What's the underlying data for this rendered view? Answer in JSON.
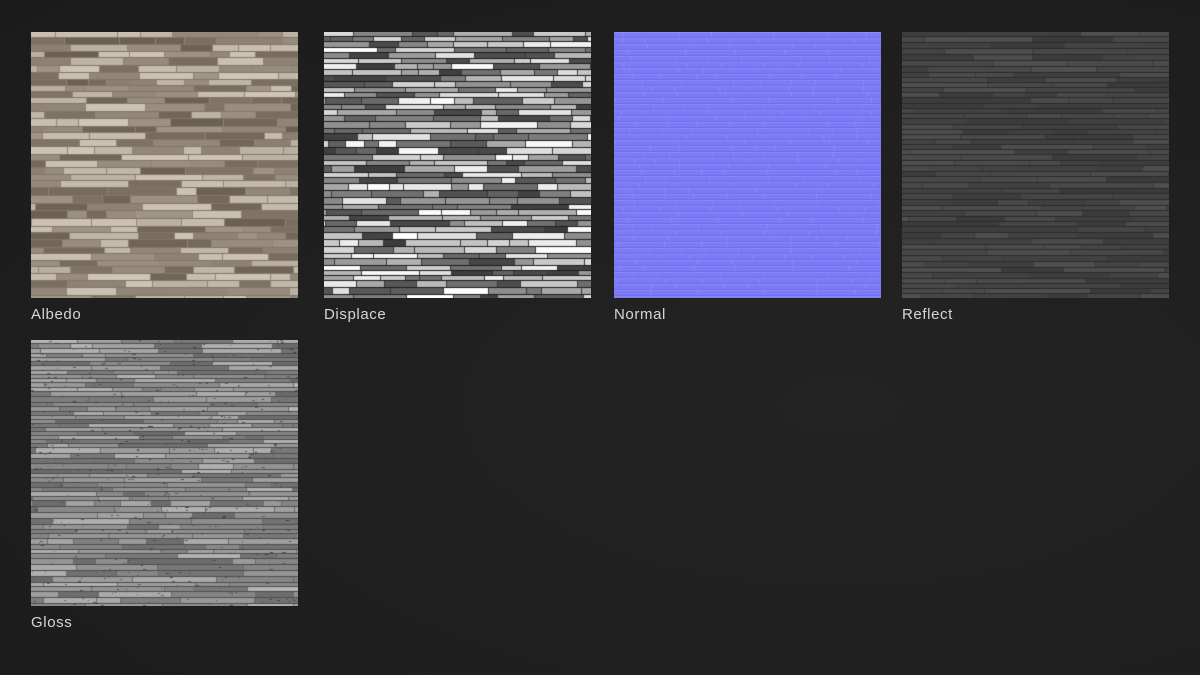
{
  "maps": [
    {
      "label": "Albedo",
      "kind": "albedo"
    },
    {
      "label": "Displace",
      "kind": "displace"
    },
    {
      "label": "Normal",
      "kind": "normal"
    },
    {
      "label": "Reflect",
      "kind": "reflect"
    },
    {
      "label": "Gloss",
      "kind": "gloss"
    }
  ],
  "colors": {
    "background": "#1f1f1f",
    "label_text": "#d6d6d6",
    "normal_base": "#7a7bf6"
  }
}
